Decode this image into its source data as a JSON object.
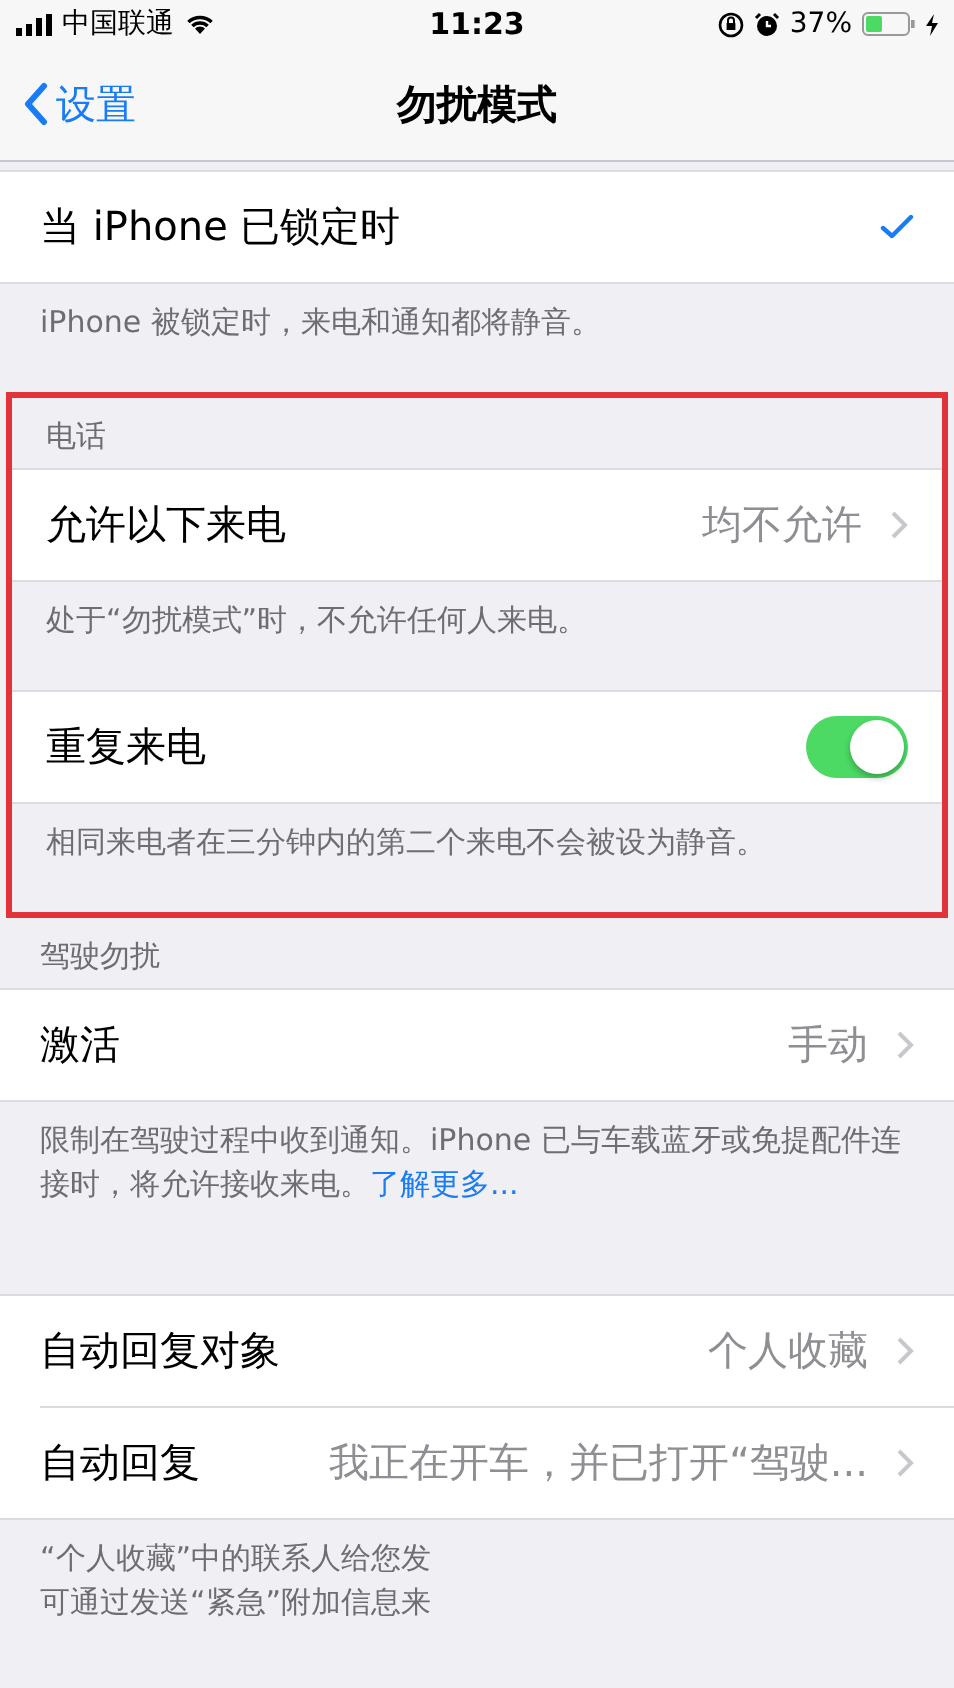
{
  "status_bar": {
    "carrier": "中国联通",
    "time": "11:23",
    "battery": "37%"
  },
  "nav": {
    "back": "设置",
    "title": "勿扰模式"
  },
  "sections": [
    {
      "rows": [
        {
          "kind": "check",
          "label": "当 iPhone 已锁定时",
          "checked": true
        }
      ],
      "footer": {
        "lines": [
          "iPhone 被锁定时，来电和通知都将静音。"
        ]
      }
    },
    {
      "header": "电话",
      "highlighted": true,
      "rows": [
        {
          "kind": "detail",
          "label": "允许以下来电",
          "value": "均不允许"
        }
      ],
      "footer": {
        "lines": [
          "处于“勿扰模式”时，不允许任何人来电。"
        ]
      }
    },
    {
      "highlighted": true,
      "rows": [
        {
          "kind": "toggle",
          "label": "重复来电",
          "on": true
        }
      ],
      "footer": {
        "lines": [
          "相同来电者在三分钟内的第二个来电不会被设为静音。"
        ]
      }
    },
    {
      "header": "驾驶勿扰",
      "rows": [
        {
          "kind": "detail",
          "label": "激活",
          "value": "手动"
        }
      ],
      "footer": {
        "lines": [
          "限制在驾驶过程中收到通知。iPhone 已与车载蓝牙或免提配件连接时，将允许接收来电。"
        ],
        "link": "了解更多..."
      }
    },
    {
      "rows": [
        {
          "kind": "detail",
          "label": "自动回复对象",
          "value": "个人收藏"
        },
        {
          "kind": "detail",
          "label": "自动回复",
          "value": "我正在开车，并已打开“驾驶..."
        }
      ],
      "footer": {
        "lines": [
          "“个人收藏”中的联系人给您发",
          "可通过发送“紧急”附加信息来"
        ]
      }
    }
  ]
}
